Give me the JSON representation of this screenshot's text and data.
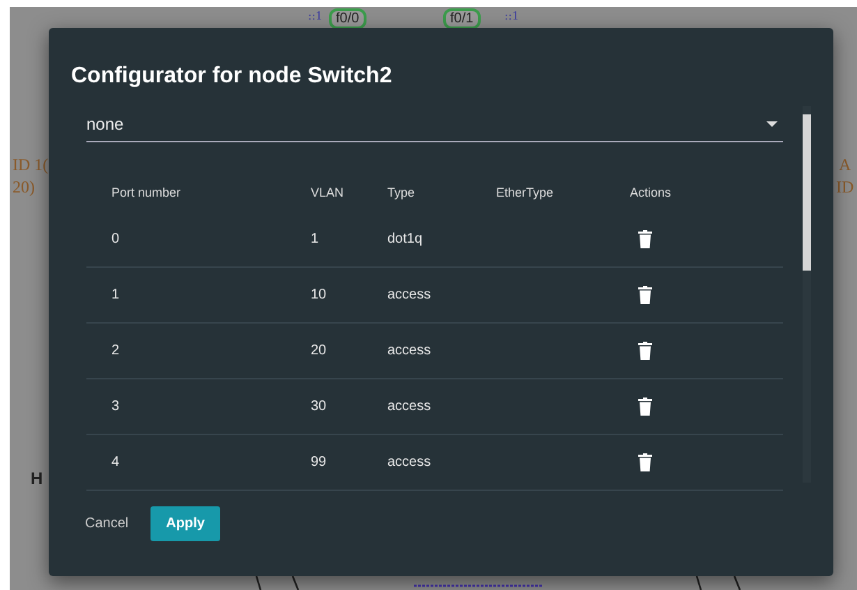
{
  "background": {
    "labels": [
      {
        "text": "::1",
        "kind": "addr"
      },
      {
        "text": "f0/0",
        "kind": "port"
      },
      {
        "text": "f0/1",
        "kind": "port"
      },
      {
        "text": "::1",
        "kind": "addr"
      },
      {
        "text": "ID 1(",
        "kind": "note"
      },
      {
        "text": "20)",
        "kind": "note"
      },
      {
        "text": "A",
        "kind": "note"
      },
      {
        "text": "ID",
        "kind": "note"
      },
      {
        "text": "H",
        "kind": "host"
      }
    ]
  },
  "dialog": {
    "title": "Configurator for node Switch2",
    "select": {
      "value": "none"
    },
    "table": {
      "columns": [
        "Port number",
        "VLAN",
        "Type",
        "EtherType",
        "Actions"
      ],
      "rows": [
        {
          "port": "0",
          "vlan": "1",
          "type": "dot1q"
        },
        {
          "port": "1",
          "vlan": "10",
          "type": "access"
        },
        {
          "port": "2",
          "vlan": "20",
          "type": "access"
        },
        {
          "port": "3",
          "vlan": "30",
          "type": "access"
        },
        {
          "port": "4",
          "vlan": "99",
          "type": "access"
        }
      ]
    },
    "buttons": [
      {
        "label": "Cancel",
        "kind": "text"
      },
      {
        "label": "Apply",
        "kind": "primary"
      }
    ]
  }
}
